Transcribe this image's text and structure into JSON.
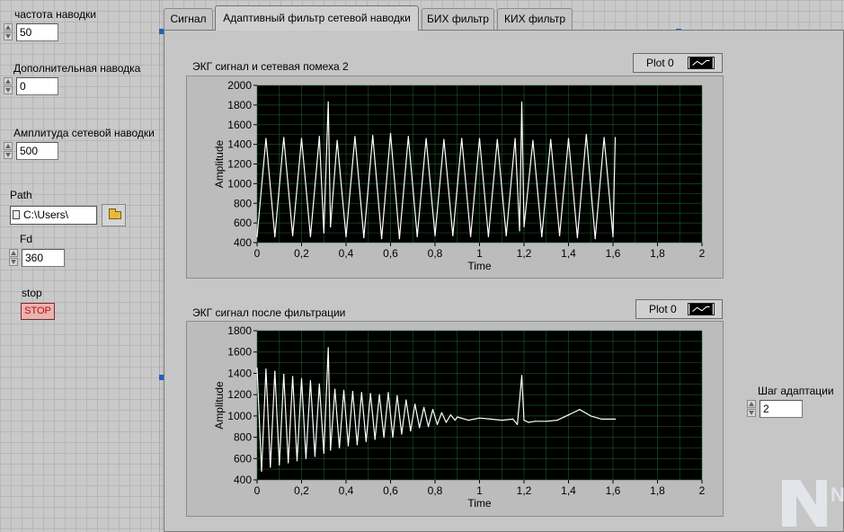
{
  "controls": {
    "freq": {
      "label": "частота наводки",
      "value": "50"
    },
    "extra": {
      "label": "Дополнительная наводка",
      "value": "0"
    },
    "amp": {
      "label": "Амплитуда сетевой наводки",
      "value": "500"
    },
    "path": {
      "label": "Path",
      "value": "C:\\Users\\"
    },
    "fd": {
      "label": "Fd",
      "value": "360"
    },
    "stop": {
      "label": "stop",
      "button": "STOP"
    },
    "step": {
      "label": "Шаг адаптации",
      "value": "2"
    }
  },
  "tabs": [
    {
      "label": "Сигнал",
      "active": false
    },
    {
      "label": "Адаптивный фильтр сетевой наводки",
      "active": true
    },
    {
      "label": "БИХ фильтр",
      "active": false
    },
    {
      "label": "КИХ фильтр",
      "active": false
    }
  ],
  "logo": {
    "text": "NI"
  },
  "colors": {
    "plot_bg": "#000000",
    "grid": "#1f6b2a",
    "trace": "#ffffff",
    "stop_text": "#d10000",
    "selection_handle": "#1c62c4"
  },
  "chart_data": [
    {
      "type": "line",
      "title": "ЭКГ сигнал и сетевая помеха 2",
      "legend": "Plot 0",
      "legend_position": "top-right",
      "xlabel": "Time",
      "ylabel": "Amplitude",
      "xlim": [
        0,
        2
      ],
      "ylim": [
        400,
        2000
      ],
      "xticks": [
        "0",
        "0,2",
        "0,4",
        "0,6",
        "0,8",
        "1",
        "1,2",
        "1,4",
        "1,6",
        "1,8",
        "2"
      ],
      "yticks": [
        "400",
        "600",
        "800",
        "1000",
        "1200",
        "1400",
        "1600",
        "1800",
        "2000"
      ],
      "grid": true,
      "series": [
        {
          "name": "Plot 0",
          "x_end": 1.61,
          "points": [
            [
              0,
              460
            ],
            [
              0.04,
              1460
            ],
            [
              0.08,
              460
            ],
            [
              0.12,
              1470
            ],
            [
              0.16,
              470
            ],
            [
              0.2,
              1460
            ],
            [
              0.24,
              460
            ],
            [
              0.28,
              1480
            ],
            [
              0.3,
              500
            ],
            [
              0.32,
              1830
            ],
            [
              0.33,
              560
            ],
            [
              0.36,
              1440
            ],
            [
              0.4,
              460
            ],
            [
              0.44,
              1480
            ],
            [
              0.48,
              450
            ],
            [
              0.52,
              1490
            ],
            [
              0.56,
              440
            ],
            [
              0.6,
              1510
            ],
            [
              0.64,
              440
            ],
            [
              0.68,
              1480
            ],
            [
              0.72,
              460
            ],
            [
              0.76,
              1460
            ],
            [
              0.8,
              470
            ],
            [
              0.84,
              1450
            ],
            [
              0.88,
              470
            ],
            [
              0.92,
              1460
            ],
            [
              0.96,
              460
            ],
            [
              1.0,
              1460
            ],
            [
              1.04,
              460
            ],
            [
              1.08,
              1450
            ],
            [
              1.12,
              470
            ],
            [
              1.16,
              1460
            ],
            [
              1.18,
              520
            ],
            [
              1.19,
              1830
            ],
            [
              1.2,
              560
            ],
            [
              1.24,
              1440
            ],
            [
              1.28,
              460
            ],
            [
              1.32,
              1450
            ],
            [
              1.36,
              470
            ],
            [
              1.4,
              1460
            ],
            [
              1.44,
              450
            ],
            [
              1.48,
              1500
            ],
            [
              1.52,
              440
            ],
            [
              1.56,
              1470
            ],
            [
              1.6,
              460
            ],
            [
              1.61,
              1470
            ]
          ]
        }
      ]
    },
    {
      "type": "line",
      "title": "ЭКГ сигнал после фильтрации",
      "legend": "Plot 0",
      "legend_position": "top-right",
      "xlabel": "Time",
      "ylabel": "Amplitude",
      "xlim": [
        0,
        2
      ],
      "ylim": [
        400,
        1800
      ],
      "xticks": [
        "0",
        "0,2",
        "0,4",
        "0,6",
        "0,8",
        "1",
        "1,2",
        "1,4",
        "1,6",
        "1,8",
        "2"
      ],
      "yticks": [
        "400",
        "600",
        "800",
        "1000",
        "1200",
        "1400",
        "1600",
        "1800"
      ],
      "grid": true,
      "series": [
        {
          "name": "Plot 0",
          "x_end": 1.61,
          "points": [
            [
              0,
              1450
            ],
            [
              0.02,
              480
            ],
            [
              0.04,
              1440
            ],
            [
              0.06,
              520
            ],
            [
              0.08,
              1420
            ],
            [
              0.1,
              540
            ],
            [
              0.12,
              1390
            ],
            [
              0.14,
              560
            ],
            [
              0.16,
              1370
            ],
            [
              0.18,
              580
            ],
            [
              0.2,
              1350
            ],
            [
              0.22,
              600
            ],
            [
              0.24,
              1330
            ],
            [
              0.26,
              620
            ],
            [
              0.28,
              1300
            ],
            [
              0.3,
              650
            ],
            [
              0.32,
              1640
            ],
            [
              0.33,
              680
            ],
            [
              0.35,
              1250
            ],
            [
              0.37,
              700
            ],
            [
              0.39,
              1240
            ],
            [
              0.41,
              720
            ],
            [
              0.43,
              1230
            ],
            [
              0.45,
              730
            ],
            [
              0.47,
              1220
            ],
            [
              0.49,
              760
            ],
            [
              0.51,
              1210
            ],
            [
              0.53,
              780
            ],
            [
              0.55,
              1200
            ],
            [
              0.57,
              800
            ],
            [
              0.59,
              1220
            ],
            [
              0.61,
              800
            ],
            [
              0.63,
              1190
            ],
            [
              0.65,
              830
            ],
            [
              0.67,
              1150
            ],
            [
              0.69,
              860
            ],
            [
              0.71,
              1110
            ],
            [
              0.73,
              890
            ],
            [
              0.75,
              1080
            ],
            [
              0.77,
              900
            ],
            [
              0.79,
              1060
            ],
            [
              0.81,
              920
            ],
            [
              0.83,
              1030
            ],
            [
              0.85,
              940
            ],
            [
              0.87,
              1010
            ],
            [
              0.89,
              960
            ],
            [
              0.9,
              990
            ],
            [
              0.95,
              960
            ],
            [
              1.0,
              980
            ],
            [
              1.05,
              970
            ],
            [
              1.1,
              960
            ],
            [
              1.15,
              970
            ],
            [
              1.17,
              920
            ],
            [
              1.18,
              1150
            ],
            [
              1.19,
              1380
            ],
            [
              1.2,
              960
            ],
            [
              1.22,
              940
            ],
            [
              1.25,
              950
            ],
            [
              1.3,
              950
            ],
            [
              1.35,
              960
            ],
            [
              1.4,
              1010
            ],
            [
              1.45,
              1060
            ],
            [
              1.5,
              1000
            ],
            [
              1.55,
              970
            ],
            [
              1.61,
              970
            ]
          ]
        }
      ]
    }
  ]
}
